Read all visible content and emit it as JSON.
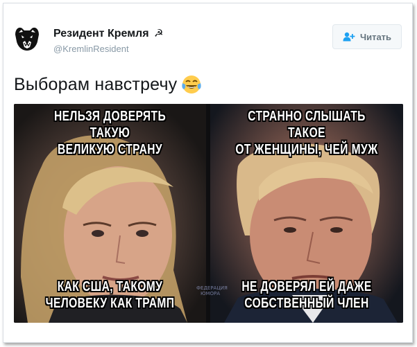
{
  "tweet": {
    "author_name": "Резидент Кремля",
    "author_emblem": "☭",
    "author_handle": "@KremlinResident",
    "follow_label": "Читать",
    "text": "Выборам навстречу",
    "emoji": "face-with-tears-of-joy"
  },
  "media": {
    "left_panel": {
      "top_caption": [
        "НЕЛЬЗЯ ДОВЕРЯТЬ ТАКУЮ",
        "ВЕЛИКУЮ СТРАНУ"
      ],
      "bottom_caption": [
        "КАК США, ТАКОМУ",
        "ЧЕЛОВЕКУ КАК ТРАМП"
      ]
    },
    "right_panel": {
      "top_caption": [
        "СТРАННО СЛЫШАТЬ ТАКОЕ",
        "ОТ ЖЕНЩИНЫ, ЧЕЙ МУЖ"
      ],
      "bottom_caption": [
        "НЕ ДОВЕРЯЛ ЕЙ ДАЖЕ",
        "СОБСТВЕННЫЙ ЧЛЕН"
      ]
    },
    "watermark": [
      "ФЕДЕРАЦИЯ",
      "ЮМОРА"
    ]
  },
  "colors": {
    "follow_icon": "#1da1f2",
    "handle": "#8899a6",
    "text": "#14171a"
  }
}
